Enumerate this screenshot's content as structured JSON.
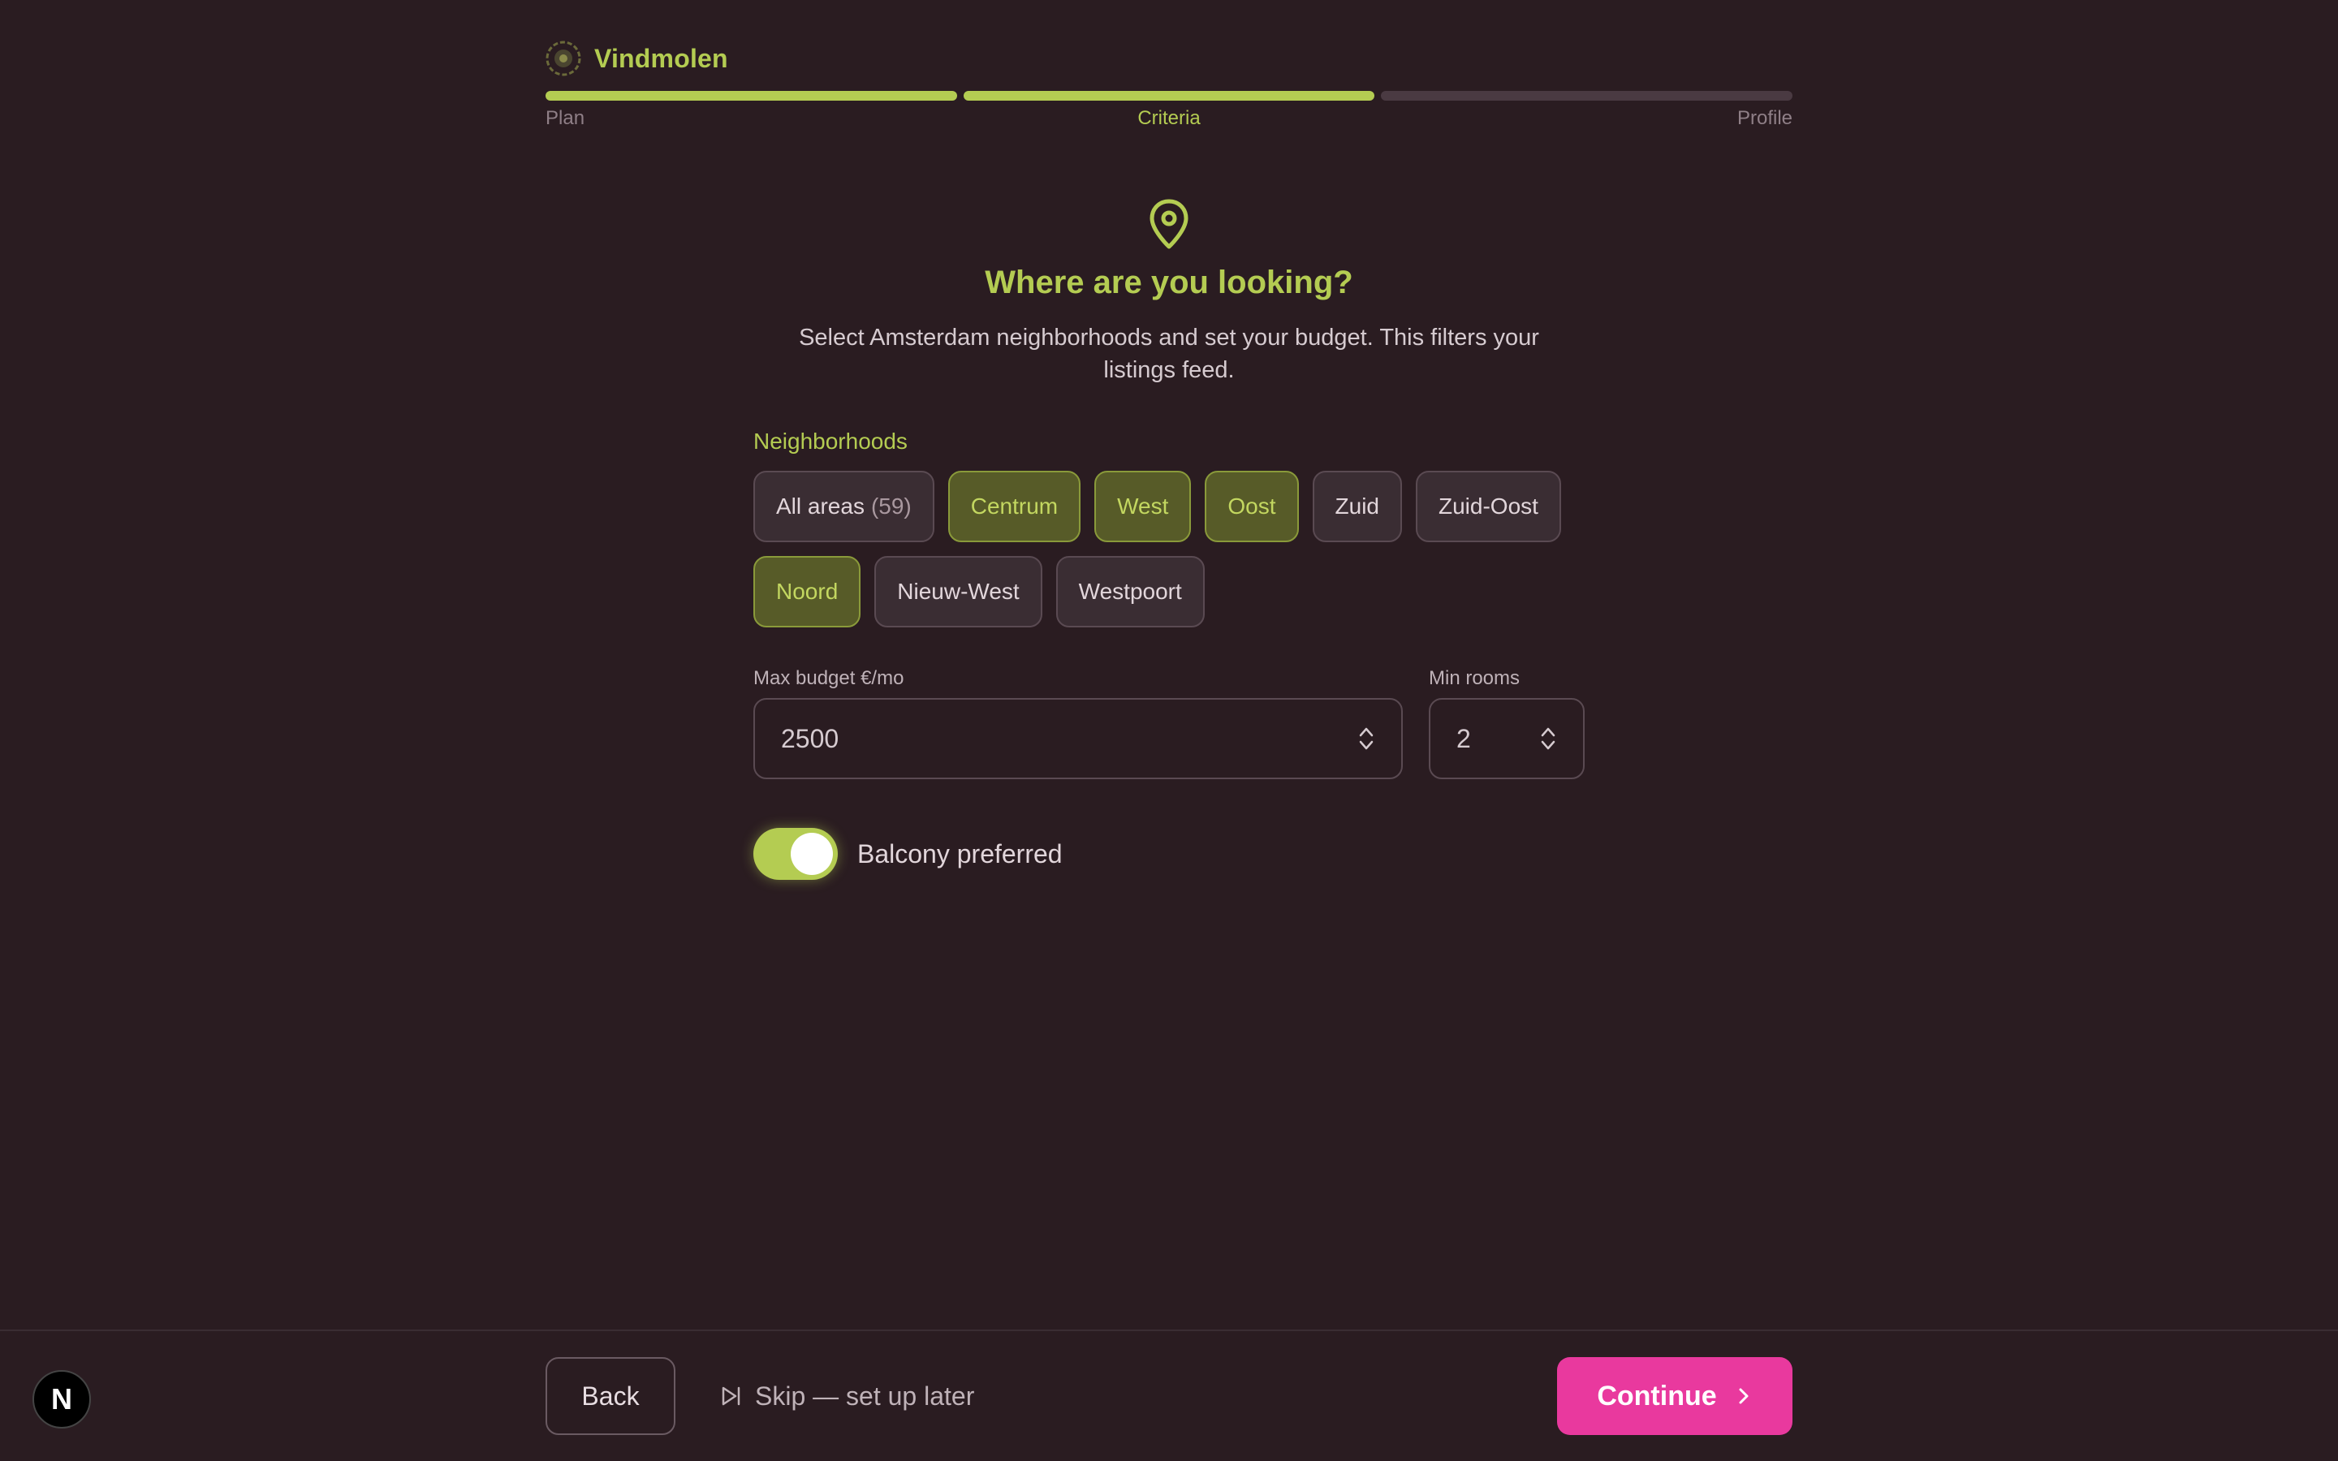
{
  "app": {
    "name": "Vindmolen"
  },
  "progress": {
    "steps": [
      {
        "label": "Plan",
        "state": "done"
      },
      {
        "label": "Criteria",
        "state": "current"
      },
      {
        "label": "Profile",
        "state": "upcoming"
      }
    ],
    "completed_segments": 2,
    "total_segments": 3
  },
  "header": {
    "icon": "map-pin-icon",
    "title": "Where are you looking?",
    "subtitle": "Select Amsterdam neighborhoods and set your budget. This filters your listings feed."
  },
  "neighborhoods": {
    "label": "Neighborhoods",
    "chips": [
      {
        "label": "All areas",
        "count": "(59)",
        "selected": false
      },
      {
        "label": "Centrum",
        "selected": true
      },
      {
        "label": "West",
        "selected": true
      },
      {
        "label": "Oost",
        "selected": true
      },
      {
        "label": "Zuid",
        "selected": false
      },
      {
        "label": "Zuid-Oost",
        "selected": false
      },
      {
        "label": "Noord",
        "selected": true
      },
      {
        "label": "Nieuw-West",
        "selected": false
      },
      {
        "label": "Westpoort",
        "selected": false
      }
    ]
  },
  "budget": {
    "label": "Max budget €/mo",
    "value": "2500"
  },
  "rooms": {
    "label": "Min rooms",
    "value": "2"
  },
  "balcony": {
    "label": "Balcony preferred",
    "on": true
  },
  "footer": {
    "badge": "N",
    "back_label": "Back",
    "skip_label": "Skip — set up later",
    "continue_label": "Continue"
  },
  "colors": {
    "background": "#2a1c21",
    "accent": "#b4cc52",
    "primary_button": "#e9399e",
    "chip_selected_bg": "#575b28"
  }
}
